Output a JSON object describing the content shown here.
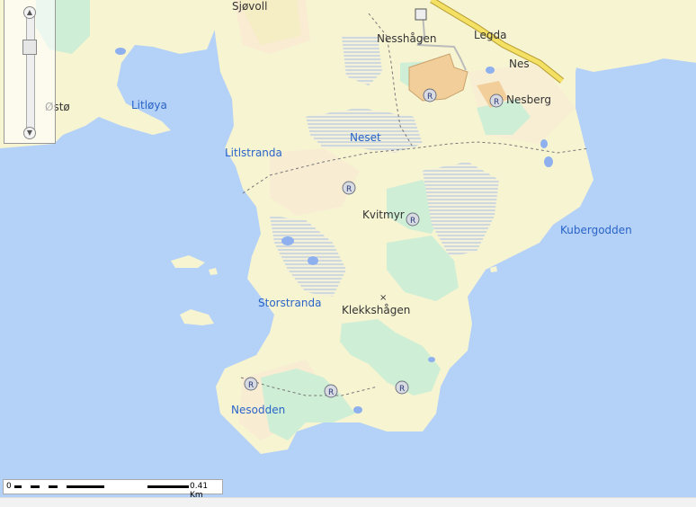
{
  "place_labels": {
    "sjovoll": "Sjøvoll",
    "nesshagen": "Nesshågen",
    "legda": "Legda",
    "nes": "Nes",
    "nesberg": "Nesberg",
    "kvitmyr": "Kvitmyr",
    "klekkshagen": "Klekkshågen",
    "osto": "Østø"
  },
  "water_labels": {
    "litloya": "Litløya",
    "neset": "Neset",
    "litlstranda": "Litlstranda",
    "kubergodden": "Kubergodden",
    "storstranda": "Storstranda",
    "nesodden": "Nesodden"
  },
  "scale_bar": {
    "min_label": "0",
    "max_label": "0.41 Km"
  },
  "colors": {
    "sea": "#b4d1f7",
    "land": "#f7f4d2",
    "forest": "#cfeed6",
    "marsh": "#a8bfe6",
    "road": "#f4e062"
  }
}
